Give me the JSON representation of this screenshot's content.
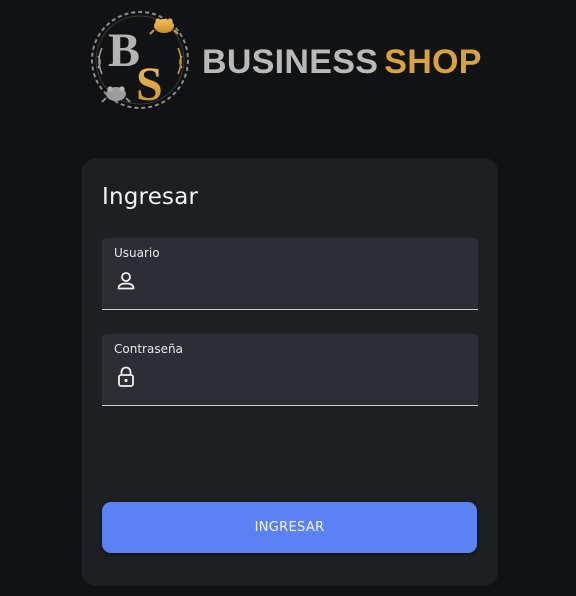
{
  "brand": {
    "emblem_letters": [
      "B",
      "S"
    ],
    "word_1": "BUSINESS",
    "word_2": "SHOP",
    "colors": {
      "silver": "#b9b9b9",
      "gold": "#d9a23b"
    }
  },
  "login": {
    "title": "Ingresar",
    "fields": [
      {
        "label": "Usuario",
        "icon": "user-icon",
        "value": "",
        "placeholder": ""
      },
      {
        "label": "Contraseña",
        "icon": "lock-icon",
        "value": "",
        "placeholder": ""
      }
    ],
    "submit_label": "INGRESAR"
  },
  "colors": {
    "background": "#111214",
    "card": "#1e1f23",
    "field": "#2d2e33",
    "accent": "#5b82f4"
  }
}
